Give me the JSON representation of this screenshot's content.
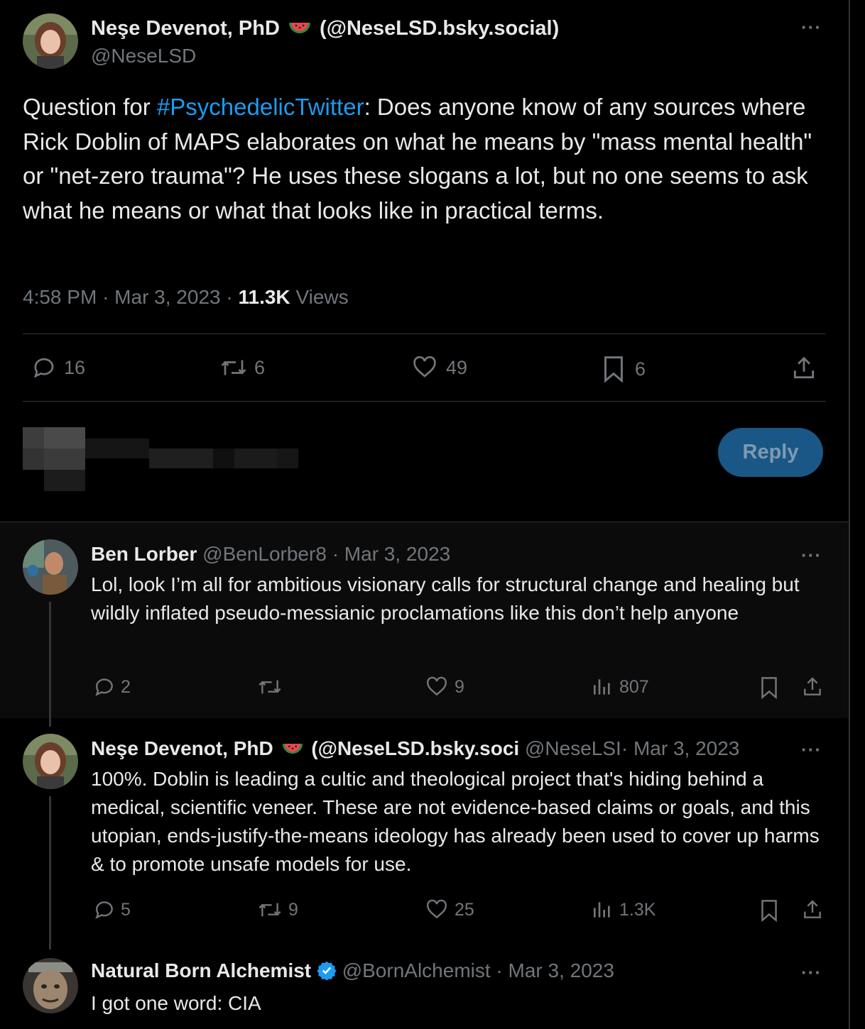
{
  "main_tweet": {
    "author_name": "Neşe Devenot, PhD",
    "author_suffix": "(@NeseLSD.bsky.social)",
    "author_handle": "@NeseLSD",
    "text_prefix": "Question for ",
    "hashtag": "#PsychedelicTwitter",
    "text_suffix": ": Does anyone know of any sources where Rick Doblin of MAPS elaborates on what he means by \"mass mental health\" or \"net-zero trauma\"? He uses these slogans a lot, but no one seems to ask what he means or what that looks like in practical terms.",
    "time": "4:58 PM",
    "date": "Mar 3, 2023",
    "views_count": "11.3K",
    "views_label": "Views",
    "stats": {
      "replies": "16",
      "retweets": "6",
      "likes": "49",
      "bookmarks": "6"
    }
  },
  "compose": {
    "reply_label": "Reply"
  },
  "replies": [
    {
      "name": "Ben Lorber",
      "handle": "@BenLorber8",
      "sep": "·",
      "date": "Mar 3, 2023",
      "text": "Lol, look I’m all for ambitious visionary calls for structural change and healing but wildly inflated pseudo-messianic proclamations like this don’t help anyone",
      "stats": {
        "replies": "2",
        "retweets": "",
        "likes": "9",
        "views": "807"
      }
    },
    {
      "name": "Neşe Devenot, PhD",
      "name_suffix": "(@NeseLSD.bsky.soci",
      "handle": "@NeseLSI",
      "sep": "·",
      "date": "Mar 3, 2023",
      "text": "100%. Doblin is leading a cultic and theological project that's hiding behind a medical, scientific veneer. These are not evidence-based claims or goals, and this utopian, ends-justify-the-means ideology has already been used to cover up harms & to promote unsafe models for use.",
      "stats": {
        "replies": "5",
        "retweets": "9",
        "likes": "25",
        "views": "1.3K"
      }
    },
    {
      "name": "Natural Born Alchemist",
      "handle": "@BornAlchemist",
      "sep": "·",
      "date": "Mar 3, 2023",
      "text": "I got one word: CIA"
    }
  ],
  "icons": {
    "more": "more-icon",
    "reply": "reply-icon",
    "retweet": "retweet-icon",
    "like": "like-icon",
    "views": "views-icon",
    "bookmark": "bookmark-icon",
    "share": "share-icon",
    "watermelon": "watermelon-emoji",
    "verified": "verified-badge-icon"
  },
  "colors": {
    "accent": "#1d9bf0",
    "background": "#000000",
    "muted": "#71767b",
    "text": "#e7e9ea",
    "reply_button": "#1a5786"
  }
}
